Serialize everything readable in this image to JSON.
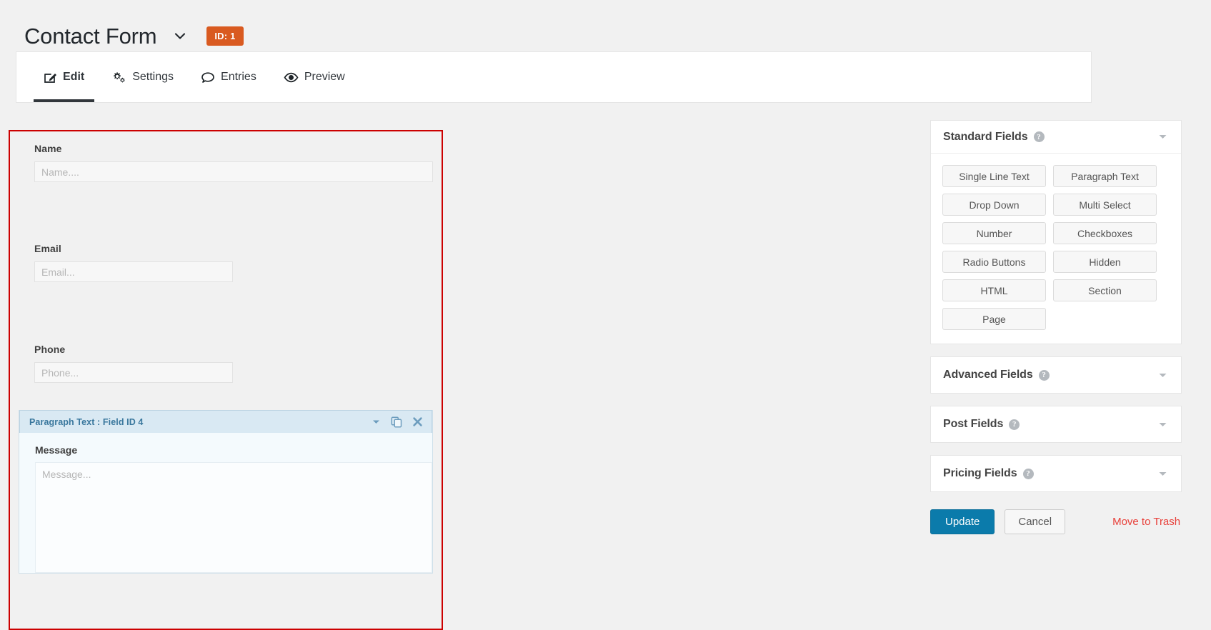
{
  "header": {
    "form_title": "Contact Form",
    "title_dropdown_icon": "chevron-down-icon",
    "form_id_badge": "ID: 1",
    "badge_color": "#d95a20"
  },
  "tabs": [
    {
      "label": "Edit",
      "icon": "edit-pencil-square-icon",
      "active": true
    },
    {
      "label": "Settings",
      "icon": "gears-icon",
      "active": false
    },
    {
      "label": "Entries",
      "icon": "speech-bubble-icon",
      "active": false
    },
    {
      "label": "Preview",
      "icon": "eye-icon",
      "active": false
    }
  ],
  "form_editor": {
    "selection_border_color": "#cc0000",
    "fields": [
      {
        "label": "Name",
        "placeholder": "Name...."
      },
      {
        "label": "Email",
        "placeholder": "Email..."
      },
      {
        "label": "Phone",
        "placeholder": "Phone..."
      }
    ],
    "selected_field": {
      "header_title": "Paragraph Text : Field ID 4",
      "label": "Message",
      "placeholder": "Message...",
      "icons": [
        "chevron-down-icon",
        "duplicate-icon",
        "close-icon"
      ]
    }
  },
  "side_panel": {
    "standard_fields": {
      "title": "Standard Fields",
      "help_icon": "help-circle-icon",
      "chevron_icon": "chevron-down-icon",
      "buttons": [
        "Single Line Text",
        "Paragraph Text",
        "Drop Down",
        "Multi Select",
        "Number",
        "Checkboxes",
        "Radio Buttons",
        "Hidden",
        "HTML",
        "Section",
        "Page"
      ]
    },
    "collapsed_panels": [
      {
        "title": "Advanced Fields",
        "help_icon": "help-circle-icon",
        "chevron_icon": "chevron-down-icon"
      },
      {
        "title": "Post Fields",
        "help_icon": "help-circle-icon",
        "chevron_icon": "chevron-down-icon"
      },
      {
        "title": "Pricing Fields",
        "help_icon": "help-circle-icon",
        "chevron_icon": "chevron-down-icon"
      }
    ],
    "actions": {
      "update_label": "Update",
      "cancel_label": "Cancel",
      "trash_label": "Move to Trash",
      "update_color": "#0b7bab",
      "trash_color": "#e8403a"
    }
  },
  "help_glyph": "?"
}
